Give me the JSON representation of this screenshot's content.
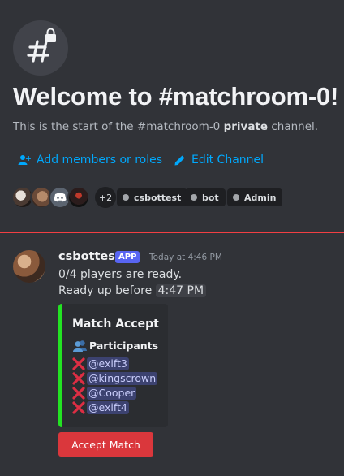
{
  "channel": {
    "icon": "hash-lock-icon",
    "welcome_title": "Welcome to #matchroom-0!",
    "sub_prefix": "This is the start of the #matchroom-0 ",
    "sub_bold": "private",
    "sub_suffix": " channel."
  },
  "actions": {
    "add_members_label": "Add members or roles",
    "edit_channel_label": "Edit Channel"
  },
  "members": {
    "more_count": "+2",
    "roles": [
      "csbottest",
      "bot",
      "Admin"
    ]
  },
  "message": {
    "author": "csbottest",
    "badge": "APP",
    "timestamp": "Today at 4:46 PM",
    "line1": "0/4 players are ready.",
    "line2_prefix": "Ready up before",
    "line2_time": "4:47 PM"
  },
  "embed": {
    "accent_color": "#23e323",
    "title": "Match Accept",
    "field_title": "Participants",
    "participants": [
      "@exift3",
      "@kingscrown",
      "@Cooper",
      "@exift4"
    ]
  },
  "button": {
    "label": "Accept Match",
    "color": "#da373c"
  },
  "colors": {
    "background": "#313338",
    "link": "#00a8fc",
    "divider": "#f23f43",
    "badge": "#5865f2"
  }
}
